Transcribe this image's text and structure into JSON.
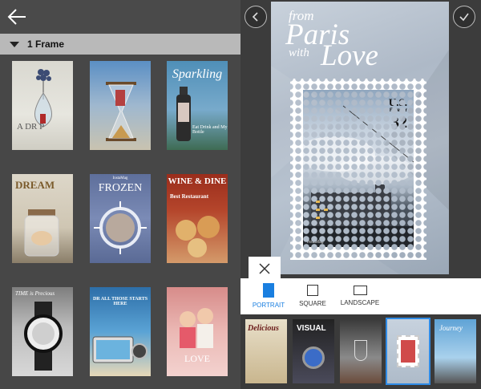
{
  "left_panel": {
    "section": {
      "label": "1 Frame"
    },
    "templates": [
      {
        "name": "A Drop",
        "text": "A DR P"
      },
      {
        "name": "Hourglass",
        "text": ""
      },
      {
        "name": "Sparkling",
        "text": "Sparkling",
        "sub": "Eat Drink and My Bottle"
      },
      {
        "name": "Dream",
        "text": "DREAM"
      },
      {
        "name": "Frozen",
        "text": "FROZEN",
        "top": "InstaMag"
      },
      {
        "name": "Wine & Dine",
        "text": "WINE & DINE",
        "sub": "Best Restaurant"
      },
      {
        "name": "Time",
        "text": "TIME is Precious"
      },
      {
        "name": "Beach",
        "text": "DR ALL THOSE STARTS HERE"
      },
      {
        "name": "Love",
        "text": "LOVE"
      }
    ]
  },
  "canvas": {
    "title_from": "from",
    "title_paris": "Paris",
    "title_with": "with",
    "title_love": "Love",
    "stamp": {
      "country": "U.S.",
      "forever": "Forever",
      "price": "32",
      "brand": "InstaMag"
    }
  },
  "layout_options": [
    {
      "label": "PORTRAIT",
      "active": true
    },
    {
      "label": "SQUARE",
      "active": false
    },
    {
      "label": "LANDSCAPE",
      "active": false
    }
  ],
  "strip": [
    {
      "label": "Delicious"
    },
    {
      "label": "VISUAL"
    },
    {
      "label": ""
    },
    {
      "label": ""
    },
    {
      "label": "Journey"
    }
  ],
  "colors": {
    "accent": "#1a7fe0",
    "selection": "#2f8be6",
    "section_bar": "#b9b9b9"
  }
}
